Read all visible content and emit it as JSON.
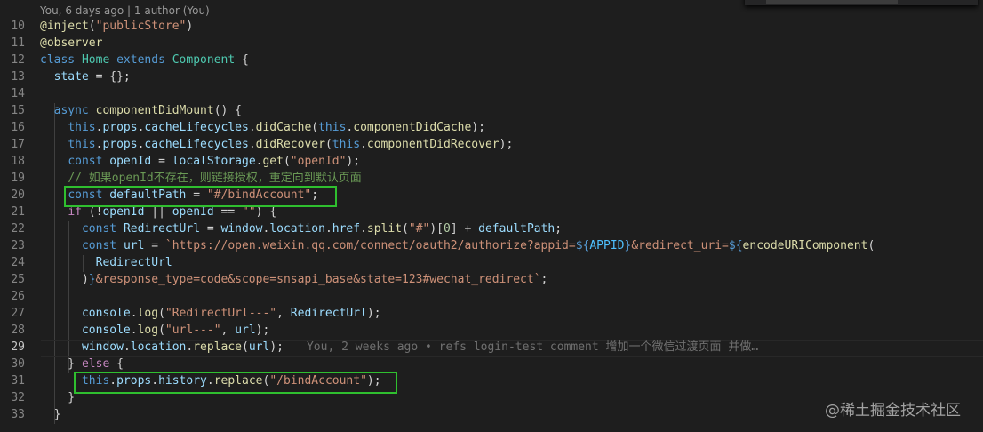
{
  "codelens": "You, 6 days ago | 1 author (You)",
  "find_widget": {
    "value": ""
  },
  "current_line": 29,
  "blame": "You, 2 weeks ago • refs login-test comment 增加一个微信过渡页面 并做…",
  "watermark": "@稀土掘金技术社区",
  "colors": {
    "background": "#1e1e1e",
    "highlight_box": "#2fbf2f"
  },
  "lines": [
    {
      "n": "10",
      "tokens": [
        [
          "dec",
          "@inject"
        ],
        [
          "pl",
          "("
        ],
        [
          "str",
          "\"publicStore\""
        ],
        [
          "pl",
          ")"
        ]
      ]
    },
    {
      "n": "11",
      "tokens": [
        [
          "dec",
          "@observer"
        ]
      ]
    },
    {
      "n": "12",
      "tokens": [
        [
          "kw",
          "class "
        ],
        [
          "cls",
          "Home "
        ],
        [
          "kw",
          "extends "
        ],
        [
          "cls",
          "Component "
        ],
        [
          "pl",
          "{"
        ]
      ]
    },
    {
      "n": "13",
      "tokens": [
        [
          "pl",
          "  "
        ],
        [
          "var",
          "state"
        ],
        [
          "pl",
          " = {};"
        ]
      ]
    },
    {
      "n": "14",
      "tokens": []
    },
    {
      "n": "15",
      "tokens": [
        [
          "pl",
          "  "
        ],
        [
          "kw",
          "async "
        ],
        [
          "fn",
          "componentDidMount"
        ],
        [
          "pl",
          "() {"
        ]
      ]
    },
    {
      "n": "16",
      "tokens": [
        [
          "pl",
          "    "
        ],
        [
          "kw",
          "this"
        ],
        [
          "pl",
          "."
        ],
        [
          "var",
          "props"
        ],
        [
          "pl",
          "."
        ],
        [
          "var",
          "cacheLifecycles"
        ],
        [
          "pl",
          "."
        ],
        [
          "fn",
          "didCache"
        ],
        [
          "pl",
          "("
        ],
        [
          "kw",
          "this"
        ],
        [
          "pl",
          "."
        ],
        [
          "fn",
          "componentDidCache"
        ],
        [
          "pl",
          ");"
        ]
      ]
    },
    {
      "n": "17",
      "tokens": [
        [
          "pl",
          "    "
        ],
        [
          "kw",
          "this"
        ],
        [
          "pl",
          "."
        ],
        [
          "var",
          "props"
        ],
        [
          "pl",
          "."
        ],
        [
          "var",
          "cacheLifecycles"
        ],
        [
          "pl",
          "."
        ],
        [
          "fn",
          "didRecover"
        ],
        [
          "pl",
          "("
        ],
        [
          "kw",
          "this"
        ],
        [
          "pl",
          "."
        ],
        [
          "fn",
          "componentDidRecover"
        ],
        [
          "pl",
          ");"
        ]
      ]
    },
    {
      "n": "18",
      "tokens": [
        [
          "pl",
          "    "
        ],
        [
          "kw",
          "const "
        ],
        [
          "var",
          "openId"
        ],
        [
          "pl",
          " = "
        ],
        [
          "var",
          "localStorage"
        ],
        [
          "pl",
          "."
        ],
        [
          "fn",
          "get"
        ],
        [
          "pl",
          "("
        ],
        [
          "str",
          "\"openId\""
        ],
        [
          "pl",
          ");"
        ]
      ]
    },
    {
      "n": "19",
      "tokens": [
        [
          "pl",
          "    "
        ],
        [
          "cmt",
          "// 如果openId不存在，则链接授权，重定向到默认页面"
        ]
      ]
    },
    {
      "n": "20",
      "tokens": [
        [
          "pl",
          "    "
        ],
        [
          "kw",
          "const "
        ],
        [
          "var",
          "defaultPath"
        ],
        [
          "pl",
          " = "
        ],
        [
          "str",
          "\"#/bindAccount\""
        ],
        [
          "pl",
          ";"
        ]
      ]
    },
    {
      "n": "21",
      "tokens": [
        [
          "pl",
          "    "
        ],
        [
          "ctl",
          "if "
        ],
        [
          "pl",
          "(!"
        ],
        [
          "var",
          "openId"
        ],
        [
          "pl",
          " || "
        ],
        [
          "var",
          "openId"
        ],
        [
          "pl",
          " == "
        ],
        [
          "str",
          "\"\""
        ],
        [
          "pl",
          ") {"
        ]
      ]
    },
    {
      "n": "22",
      "tokens": [
        [
          "pl",
          "      "
        ],
        [
          "kw",
          "const "
        ],
        [
          "var",
          "RedirectUrl"
        ],
        [
          "pl",
          " = "
        ],
        [
          "var",
          "window"
        ],
        [
          "pl",
          "."
        ],
        [
          "var",
          "location"
        ],
        [
          "pl",
          "."
        ],
        [
          "var",
          "href"
        ],
        [
          "pl",
          "."
        ],
        [
          "fn",
          "split"
        ],
        [
          "pl",
          "("
        ],
        [
          "str",
          "\"#\""
        ],
        [
          "pl",
          ")["
        ],
        [
          "num",
          "0"
        ],
        [
          "pl",
          "] + "
        ],
        [
          "var",
          "defaultPath"
        ],
        [
          "pl",
          ";"
        ]
      ]
    },
    {
      "n": "23",
      "tokens": [
        [
          "pl",
          "      "
        ],
        [
          "kw",
          "const "
        ],
        [
          "var",
          "url"
        ],
        [
          "pl",
          " = "
        ],
        [
          "str",
          "`https://open.weixin.qq.com/connect/oauth2/authorize?appid="
        ],
        [
          "kw",
          "${"
        ],
        [
          "cst",
          "APPID"
        ],
        [
          "kw",
          "}"
        ],
        [
          "str",
          "&redirect_uri="
        ],
        [
          "kw",
          "${"
        ],
        [
          "fn",
          "encodeURIComponent"
        ],
        [
          "pl",
          "("
        ]
      ]
    },
    {
      "n": "24",
      "tokens": [
        [
          "pl",
          "        "
        ],
        [
          "var",
          "RedirectUrl"
        ]
      ]
    },
    {
      "n": "25",
      "tokens": [
        [
          "pl",
          "      )"
        ],
        [
          "kw",
          "}"
        ],
        [
          "str",
          "&response_type=code&scope=snsapi_base&state=123#wechat_redirect`"
        ],
        [
          "pl",
          ";"
        ]
      ]
    },
    {
      "n": "26",
      "tokens": []
    },
    {
      "n": "27",
      "tokens": [
        [
          "pl",
          "      "
        ],
        [
          "var",
          "console"
        ],
        [
          "pl",
          "."
        ],
        [
          "fn",
          "log"
        ],
        [
          "pl",
          "("
        ],
        [
          "str",
          "\"RedirectUrl---\""
        ],
        [
          "pl",
          ", "
        ],
        [
          "var",
          "RedirectUrl"
        ],
        [
          "pl",
          ");"
        ]
      ]
    },
    {
      "n": "28",
      "tokens": [
        [
          "pl",
          "      "
        ],
        [
          "var",
          "console"
        ],
        [
          "pl",
          "."
        ],
        [
          "fn",
          "log"
        ],
        [
          "pl",
          "("
        ],
        [
          "str",
          "\"url---\""
        ],
        [
          "pl",
          ", "
        ],
        [
          "var",
          "url"
        ],
        [
          "pl",
          ");"
        ]
      ]
    },
    {
      "n": "29",
      "tokens": [
        [
          "pl",
          "      "
        ],
        [
          "var",
          "window"
        ],
        [
          "pl",
          "."
        ],
        [
          "var",
          "location"
        ],
        [
          "pl",
          "."
        ],
        [
          "fn",
          "replace"
        ],
        [
          "pl",
          "("
        ],
        [
          "var",
          "url"
        ],
        [
          "pl",
          ");"
        ]
      ]
    },
    {
      "n": "30",
      "tokens": [
        [
          "pl",
          "    } "
        ],
        [
          "ctl",
          "else "
        ],
        [
          "pl",
          "{"
        ]
      ]
    },
    {
      "n": "31",
      "tokens": [
        [
          "pl",
          "      "
        ],
        [
          "kw",
          "this"
        ],
        [
          "pl",
          "."
        ],
        [
          "var",
          "props"
        ],
        [
          "pl",
          "."
        ],
        [
          "var",
          "history"
        ],
        [
          "pl",
          "."
        ],
        [
          "fn",
          "replace"
        ],
        [
          "pl",
          "("
        ],
        [
          "str",
          "\"/bindAccount\""
        ],
        [
          "pl",
          ");"
        ]
      ]
    },
    {
      "n": "32",
      "tokens": [
        [
          "pl",
          "    }"
        ]
      ]
    },
    {
      "n": "33",
      "tokens": [
        [
          "pl",
          "  }"
        ]
      ]
    }
  ]
}
